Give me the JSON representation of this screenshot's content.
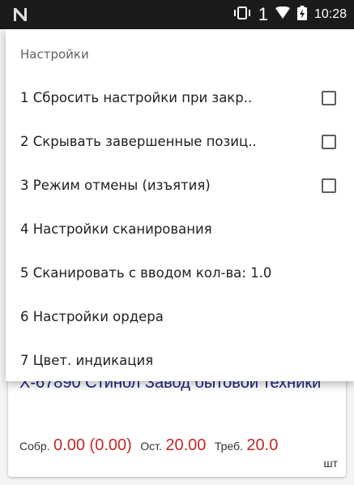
{
  "status_bar": {
    "app_icon": "n-logo-icon",
    "vibrate_icon": "vibrate-icon",
    "sim_number": "1",
    "wifi_icon": "wifi-icon",
    "battery_icon": "battery-charging-icon",
    "time": "10:28"
  },
  "menu": {
    "title": "Настройки",
    "items": [
      {
        "label": "1 Сбросить настройки при закр..",
        "has_checkbox": true,
        "checked": false
      },
      {
        "label": "2 Скрывать завершенные позиц..",
        "has_checkbox": true,
        "checked": false
      },
      {
        "label": "3 Режим отмены (изъятия)",
        "has_checkbox": true,
        "checked": false
      },
      {
        "label": "4 Настройки сканирования",
        "has_checkbox": false
      },
      {
        "label": "5 Сканировать с вводом кол-ва: 1.0",
        "has_checkbox": false
      },
      {
        "label": "6 Настройки ордера",
        "has_checkbox": false
      },
      {
        "label": "7 Цвет. индикация",
        "has_checkbox": false
      }
    ]
  },
  "card": {
    "name": "Х-67890 Стинол Завод бытовой техники",
    "collected_label": "Собр.",
    "collected_value": "0.00 (0.00)",
    "remaining_label": "Ост.",
    "remaining_value": "20.00",
    "required_label": "Треб.",
    "required_value": "20.0",
    "unit": "шт"
  },
  "colors": {
    "status_bar": "#1b1b1b",
    "product_name": "#1a237e",
    "qty_value": "#c62828"
  }
}
